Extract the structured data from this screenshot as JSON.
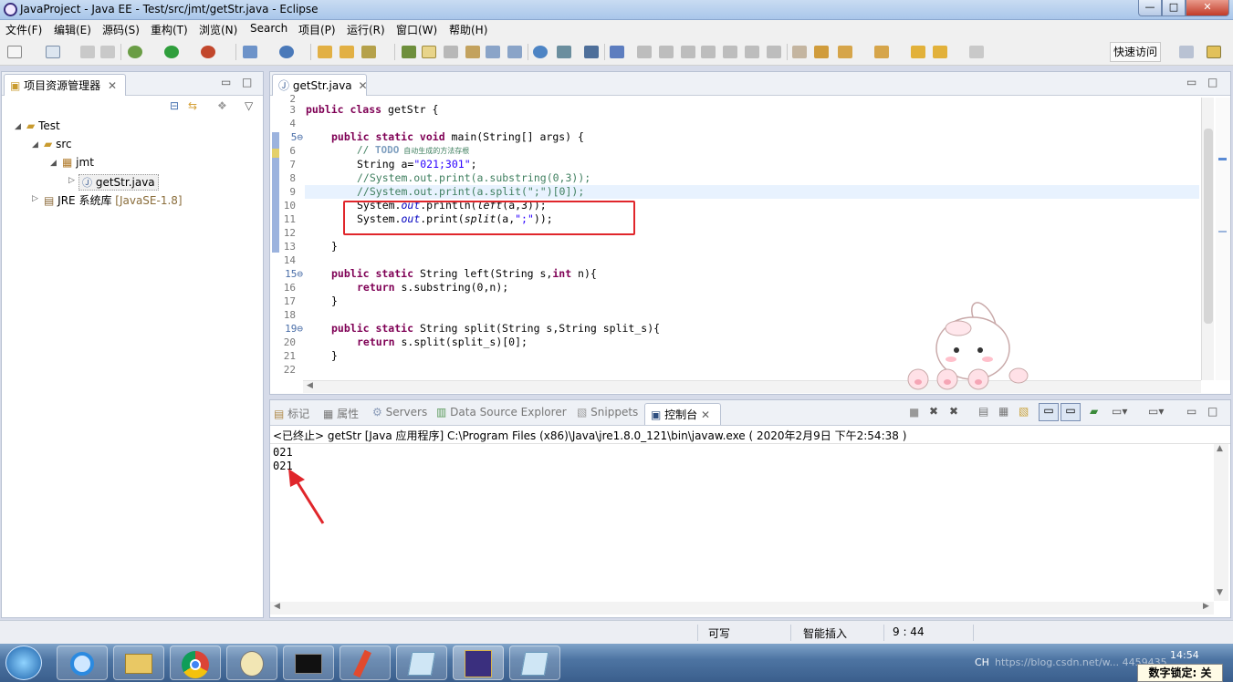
{
  "window": {
    "title": "JavaProject  -  Java EE  -  Test/src/jmt/getStr.java  -  Eclipse",
    "min": "—",
    "max": "□",
    "close": "✕"
  },
  "menu": [
    "文件(F)",
    "编辑(E)",
    "源码(S)",
    "重构(T)",
    "浏览(N)",
    "Search",
    "项目(P)",
    "运行(R)",
    "窗口(W)",
    "帮助(H)"
  ],
  "toolbar": {
    "quick_access": "快速访问"
  },
  "explorer": {
    "title": "项目资源管理器",
    "tree": {
      "project": "Test",
      "src": "src",
      "package": "jmt",
      "file": "getStr.java",
      "jre": "JRE 系统库",
      "jre_version": "[JavaSE-1.8]"
    }
  },
  "editor": {
    "tab": "getStr.java",
    "line_numbers": [
      "2",
      "3",
      "4",
      "5⊖",
      "6",
      "7",
      "8",
      "9",
      "10",
      "11",
      "12",
      "13",
      "14",
      "15⊖",
      "16",
      "17",
      "18",
      "19⊖",
      "20",
      "21",
      "22"
    ],
    "code": {
      "l3_kw": "public class",
      "l3_rest": " getStr {",
      "l5_kw": "public static void",
      "l5_rest": " main(String[] args) {",
      "l6_pre": "// ",
      "l6_todo": "TODO",
      "l6_note": " 自动生成的方法存根",
      "l7_a": "String a=",
      "l7_str": "\"021;301\"",
      "l7_b": ";",
      "l8": "//System.out.print(a.substring(0,3));",
      "l9": "//System.out.print(a.split(\";\")[0]);",
      "l10_a": "System.",
      "l10_out": "out",
      "l10_b": ".println(",
      "l10_left": "left",
      "l10_c": "(a,3));",
      "l11_a": "System.",
      "l11_out": "out",
      "l11_b": ".print(",
      "l11_split": "split",
      "l11_c": "(a,",
      "l11_str": "\";\"",
      "l11_d": "));",
      "l13": "}",
      "l15_kw": "public static",
      "l15_a": " String left(String s,",
      "l15_int": "int",
      "l15_b": " n){",
      "l16_kw": "return",
      "l16_rest": " s.substring(0,n);",
      "l17": "}",
      "l19_kw": "public static",
      "l19_rest": " String split(String s,String split_s){",
      "l20_kw": "return",
      "l20_rest": " s.split(split_s)[0];",
      "l21": "}"
    }
  },
  "console": {
    "tabs": [
      "标记",
      "属性",
      "Servers",
      "Data Source Explorer",
      "Snippets",
      "控制台"
    ],
    "header": "<已终止> getStr [Java 应用程序] C:\\Program Files (x86)\\Java\\jre1.8.0_121\\bin\\javaw.exe ( 2020年2月9日 下午2:54:38 )",
    "output": [
      "021",
      "021"
    ]
  },
  "status": {
    "writable": "可写",
    "insert_mode": "智能插入",
    "position": "9 : 44"
  },
  "taskbar": {
    "clock": "14:54",
    "lang": "CH",
    "numlock": "数字锁定: 关",
    "watermark": "https://blog.csdn.net/w... 4459435"
  },
  "colors": {
    "annotation_red": "#e0262b",
    "keyword": "#7f0055",
    "comment": "#3f7f5f",
    "string": "#2a00ff"
  }
}
